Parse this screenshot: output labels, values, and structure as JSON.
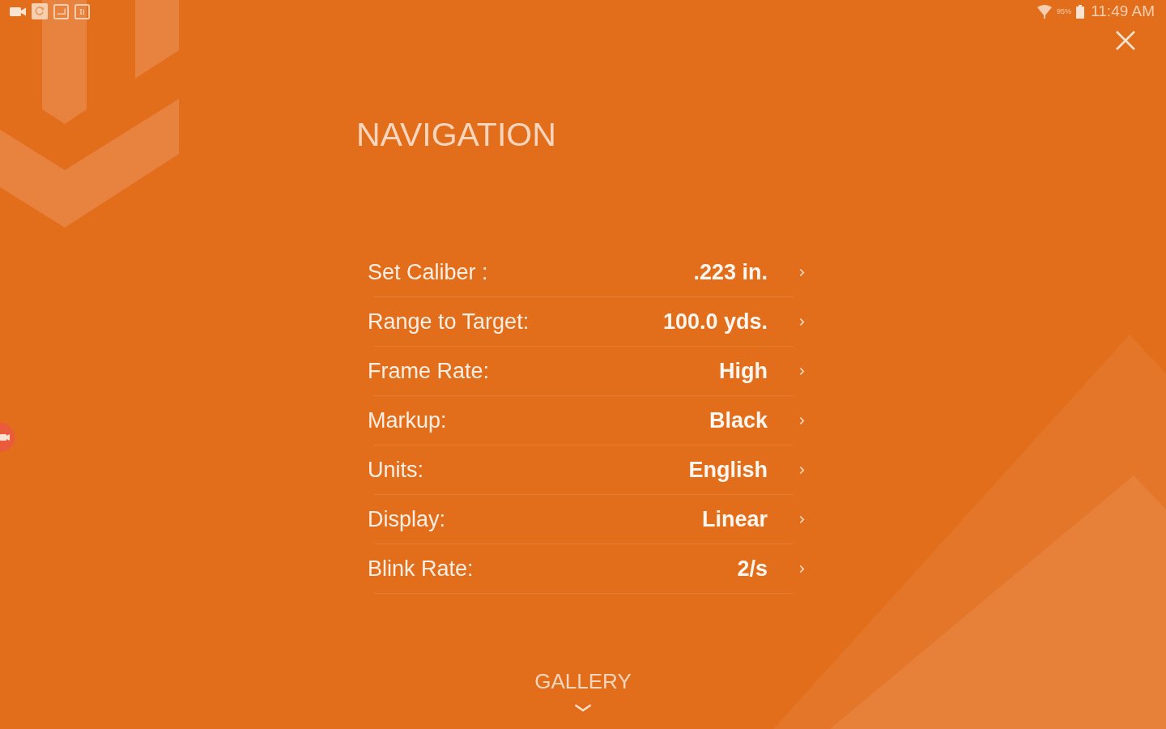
{
  "status_bar": {
    "battery": "95%",
    "time": "11:49 AM"
  },
  "title": "NAVIGATION",
  "settings": [
    {
      "label": "Set Caliber :",
      "value": ".223 in."
    },
    {
      "label": "Range to Target:",
      "value": "100.0 yds."
    },
    {
      "label": "Frame Rate:",
      "value": "High"
    },
    {
      "label": "Markup:",
      "value": "Black"
    },
    {
      "label": "Units:",
      "value": "English"
    },
    {
      "label": "Display:",
      "value": "Linear"
    },
    {
      "label": "Blink Rate:",
      "value": "2/s"
    }
  ],
  "footer": {
    "label": "GALLERY"
  }
}
